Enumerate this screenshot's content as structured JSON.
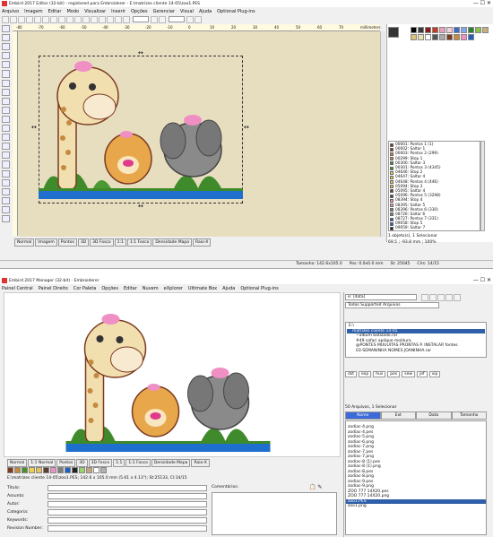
{
  "editor": {
    "title": "Embird 2017 Editor (32-bit) - registered para Embroiderer - E:\\matrizes cliente 14-05\\zoo1.PES",
    "menu": [
      "Arquivo",
      "Imagem",
      "Editar",
      "Modo",
      "Visualizar",
      "Inserir",
      "Opções",
      "Gerenciar",
      "Visual",
      "Ajuda",
      "Optional Plug-ins"
    ],
    "ruler_labels": [
      "-80",
      "-70",
      "-60",
      "-50",
      "-40",
      "-30",
      "-20",
      "-10",
      "0",
      "10",
      "20",
      "30",
      "40",
      "50",
      "60",
      "70",
      "millimeters"
    ],
    "tabs": [
      "Normal",
      "Imagem",
      "Pontos",
      "3D",
      "3D Fosco",
      "1:1",
      "1:1 Fosco",
      "Densidade Mapa",
      "Raio-X"
    ],
    "status_left": "1 objeto(s), 1 Selecionar",
    "status_size": "69.5 ; -93.8 mm ; 100%",
    "status_bottom": [
      "Tamanho: 142.6x105.0",
      "Pos: 0.0x0.0 mm",
      "St: 25045",
      "Clrs: 14/15"
    ],
    "color_list": [
      {
        "label": "00001: Pontos 1 (1)",
        "color": "#7a3a20"
      },
      {
        "label": "00002: Saltar 1",
        "color": "#7a3a20"
      },
      {
        "label": "00003: Pontos 2 (299)",
        "color": "#c58a3f"
      },
      {
        "label": "00299: Stop 1",
        "color": "#c58a3f"
      },
      {
        "label": "00300: Saltar 3",
        "color": "#4a8f2a"
      },
      {
        "label": "00301: Pontos 3 (4345)",
        "color": "#4a8f2a"
      },
      {
        "label": "04646: Stop 2",
        "color": "#f0d24a"
      },
      {
        "label": "04647: Saltar 4",
        "color": "#f0d24a"
      },
      {
        "label": "04648: Pontos 4 (446)",
        "color": "#e8c05a"
      },
      {
        "label": "05094: Stop 3",
        "color": "#e8c05a"
      },
      {
        "label": "05095: Saltar 4",
        "color": "#5a4030"
      },
      {
        "label": "05096: Pontos 5 (3298)",
        "color": "#5a4030"
      },
      {
        "label": "08394: Stop 4",
        "color": "#ef8fc4"
      },
      {
        "label": "08395: Saltar 5",
        "color": "#ef8fc4"
      },
      {
        "label": "08396: Pontos 6 (330)",
        "color": "#7d7d7d"
      },
      {
        "label": "08726: Saltar 6",
        "color": "#7d7d7d"
      },
      {
        "label": "08727: Pontos 7 (331)",
        "color": "#1f5fbf"
      },
      {
        "label": "09058: Stop 5",
        "color": "#1f5fbf"
      },
      {
        "label": "09059: Saltar 7",
        "color": "#222222"
      }
    ]
  },
  "manager": {
    "title": "Embird 2017 Manager (32-bit) - Embroiderer",
    "menu": [
      "Painel Central",
      "Painel Direito",
      "Cor Paleta",
      "Opções",
      "Editar",
      "Nuvem",
      "eXplorer",
      "Ultimate Box",
      "Ajuda",
      "Optional Plug-ins"
    ],
    "tabs": [
      "Normal",
      "1:1 Normal",
      "Pontos",
      "3D",
      "3D Fosco",
      "1:1",
      "1:1 Fosco",
      "Densidade Mapa",
      "Raio-X"
    ],
    "file_info": "E:\\matrizes cliente 14-05\\zoo1.PES;   142.6 x 105.0 mm (5.61 x 4.13\");   St:25133, Cl:14/15",
    "form": {
      "fields": [
        "Título:",
        "Assunto:",
        "Autor:",
        "Categoria:",
        "Keywords:",
        "Revision Number:"
      ],
      "comments_label": "Comentários:"
    },
    "path_value": "e: [data]",
    "filter_value": "Todos Supported Arquivos",
    "tree": [
      "E:\\",
      "matrizes cliente 14-05",
      "~album batizado.rar",
      "#49 safari aplique moldura",
      "@PONTES MUUUITAS PRONTAS P. INSTALAR fontes",
      "03-SEMANINHA NOMES JOANINHA.rar"
    ],
    "ext_buttons": [
      "dst",
      "exp",
      "hus",
      "pes",
      "sew",
      "jef",
      "vip"
    ],
    "count_label": "50 Arquivos, 1 Selecionar",
    "columns": [
      "Nome",
      "Ext",
      "Data",
      "Tamanho"
    ],
    "files": [
      "zodiac-4.png",
      "zodiac-4.pes",
      "zodiac-5.png",
      "zodiac-6.png",
      "zodiac-7.png",
      "zodiac-7.pes",
      "zodiac-7.png",
      "zodiac-8 (1).pes",
      "zodiac-8 (1).png",
      "zodiac-8.pes",
      "zodiac-8.png",
      "zodiac-9.pes",
      "zodiac-9.png",
      "ZOO 777 14X20.pes",
      "ZOO 777 14X20.png",
      "zoo1.PES",
      "zoo1.png"
    ],
    "selected_file": "zoo1.PES"
  },
  "palette": {
    "editor_colors": [
      "#000000",
      "#3b3b3b",
      "#8b1a1a",
      "#c23b22",
      "#e8a0b8",
      "#f2d0dc",
      "#3d6bc4",
      "#7fa9e8",
      "#2f7d32",
      "#8bc34a",
      "#c7b079",
      "#d9c27a",
      "#f1e3a8",
      "#ffffff",
      "#555555",
      "#aaaaaa",
      "#7a3a20",
      "#c58a3f",
      "#ef8fc4",
      "#1f5fbf"
    ],
    "manager_colors": [
      "#7a3a20",
      "#c58a3f",
      "#4a8f2a",
      "#f0d24a",
      "#e8c05a",
      "#5a4030",
      "#ef8fc4",
      "#7d7d7d",
      "#1f5fbf",
      "#222222",
      "#9ad26a",
      "#c9a37a",
      "#ffffff",
      "#b0b0b0"
    ]
  }
}
